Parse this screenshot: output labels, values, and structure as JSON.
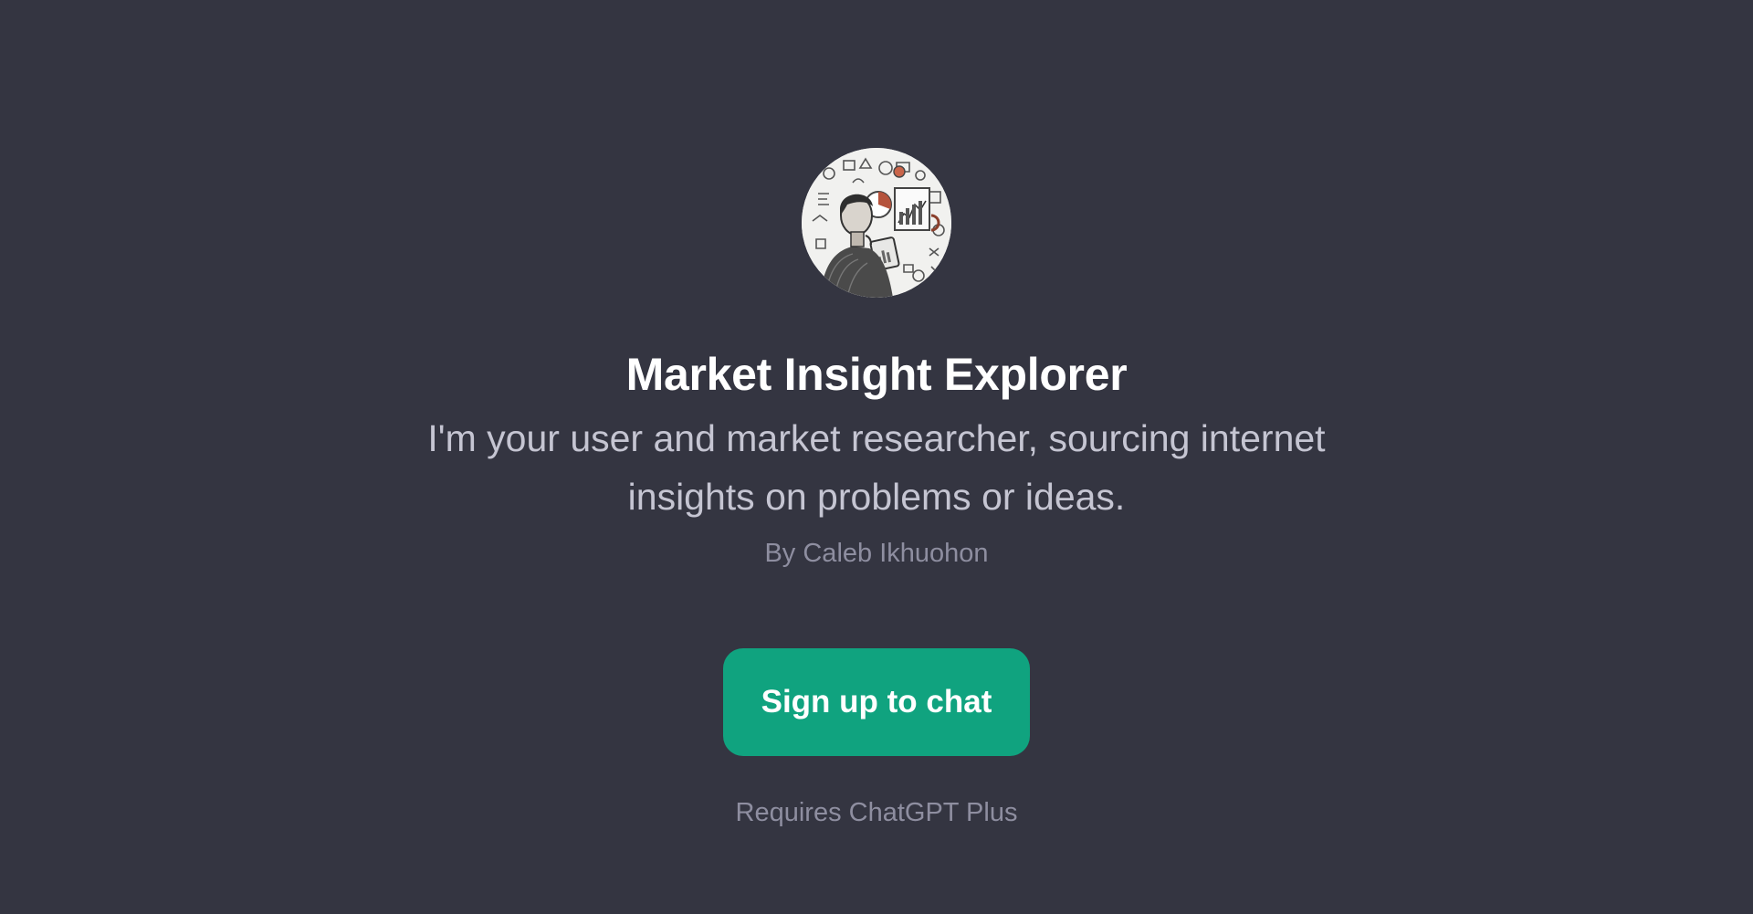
{
  "gpt": {
    "title": "Market Insight Explorer",
    "description": "I'm your user and market researcher, sourcing internet insights on problems or ideas.",
    "author": "By Caleb Ikhuohon",
    "avatar_icon": "researcher-sketch-avatar"
  },
  "actions": {
    "signup_label": "Sign up to chat",
    "requirement": "Requires ChatGPT Plus"
  },
  "theme": {
    "background": "#343541",
    "accent": "#10a37f",
    "title_color": "#ffffff",
    "body_color": "#c5c5d2",
    "muted_color": "#8e8ea0"
  }
}
